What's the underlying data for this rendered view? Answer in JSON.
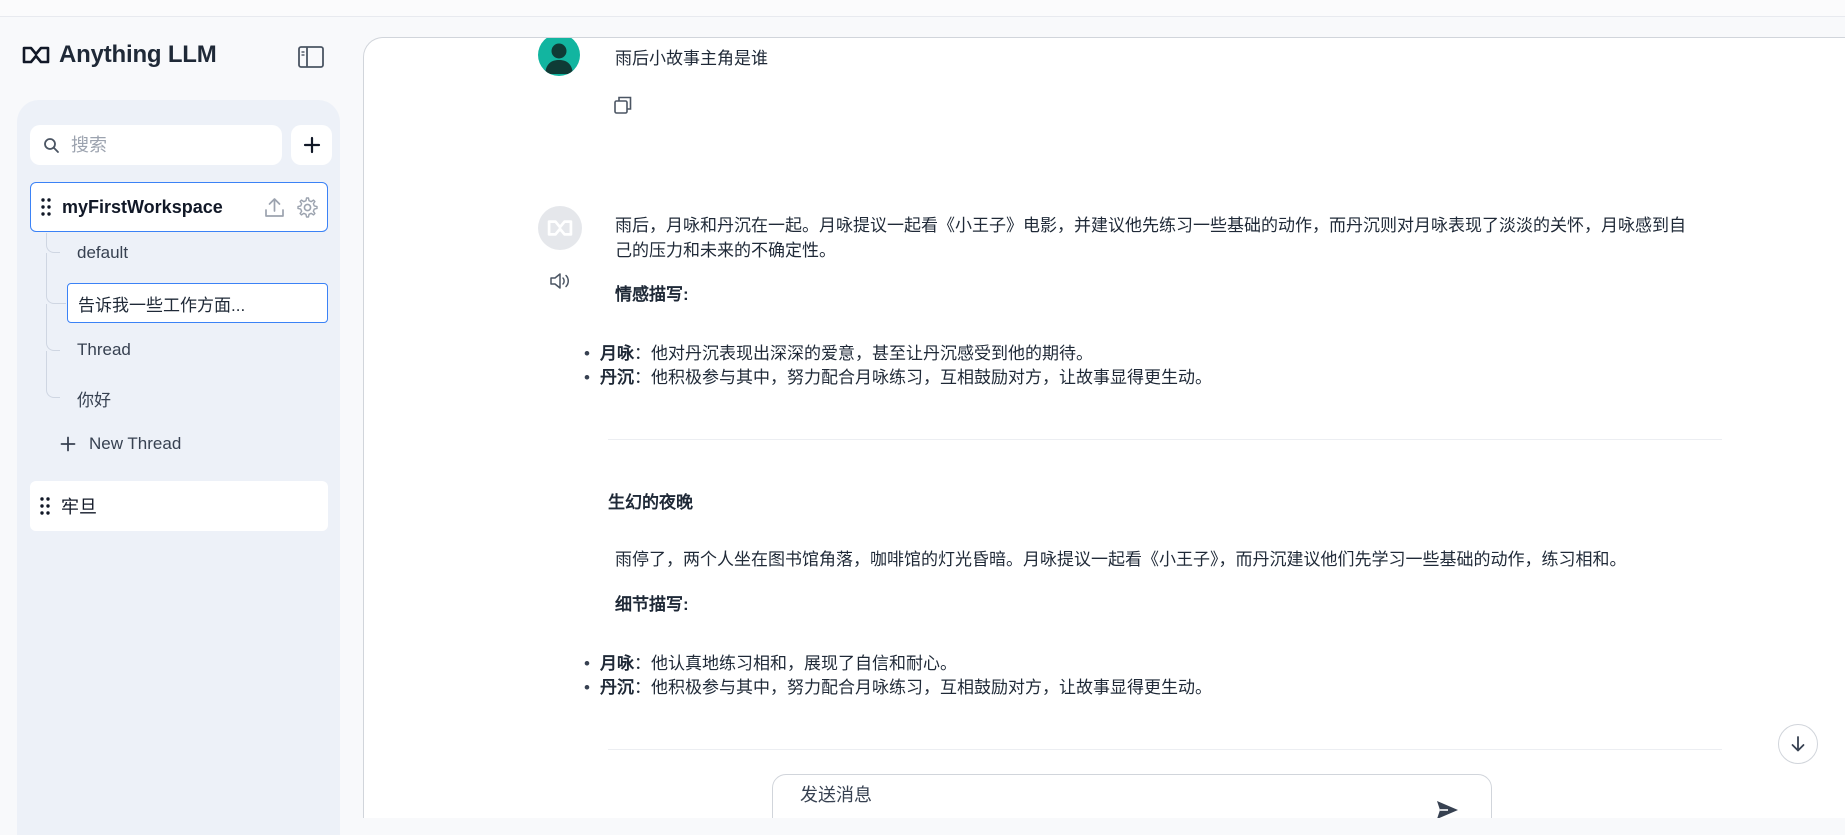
{
  "app": {
    "name": "Anything LLM"
  },
  "sidebar": {
    "search_placeholder": "搜索",
    "workspaces": [
      {
        "name": "myFirstWorkspace",
        "threads": [
          "default",
          "告诉我一些工作方面...",
          "Thread",
          "你好"
        ],
        "active_thread": "告诉我一些工作方面...",
        "new_thread_label": "New Thread"
      },
      {
        "name": "牢旦"
      }
    ]
  },
  "chat": {
    "user_message": "雨后小故事主角是谁",
    "reply": {
      "para1_line1": "雨后，月咏和丹沉在一起。月咏提议一起看《小王子》电影，并建议他先练习一些基础的动作，而丹沉则对月咏表现了淡淡的关怀，月咏感到自",
      "para1_line2": "己的压力和未来的不确定性。",
      "heading1": "情感描写:",
      "bullets1": [
        {
          "name": "月咏",
          "text": "：他对丹沉表现出深深的爱意，甚至让丹沉感受到他的期待。"
        },
        {
          "name": "丹沉",
          "text": "：他积极参与其中，努力配合月咏练习，互相鼓励对方，让故事显得更生动。"
        }
      ],
      "section_title": "生幻的夜晚",
      "para2": "雨停了，两个人坐在图书馆角落，咖啡馆的灯光昏暗。月咏提议一起看《小王子》，而丹沉建议他们先学习一些基础的动作，练习相和。",
      "heading2": "细节描写:",
      "bullets2": [
        {
          "name": "月咏",
          "text": "：他认真地练习相和，展现了自信和耐心。"
        },
        {
          "name": "丹沉",
          "text": "：他积极参与其中，努力配合月咏练习，互相鼓励对方，让故事显得更生动。"
        }
      ]
    },
    "composer_placeholder": "发送消息"
  },
  "colors": {
    "accent": "#3b82f6",
    "user_avatar": "#12b5a0",
    "panel": "#edf1f8"
  }
}
